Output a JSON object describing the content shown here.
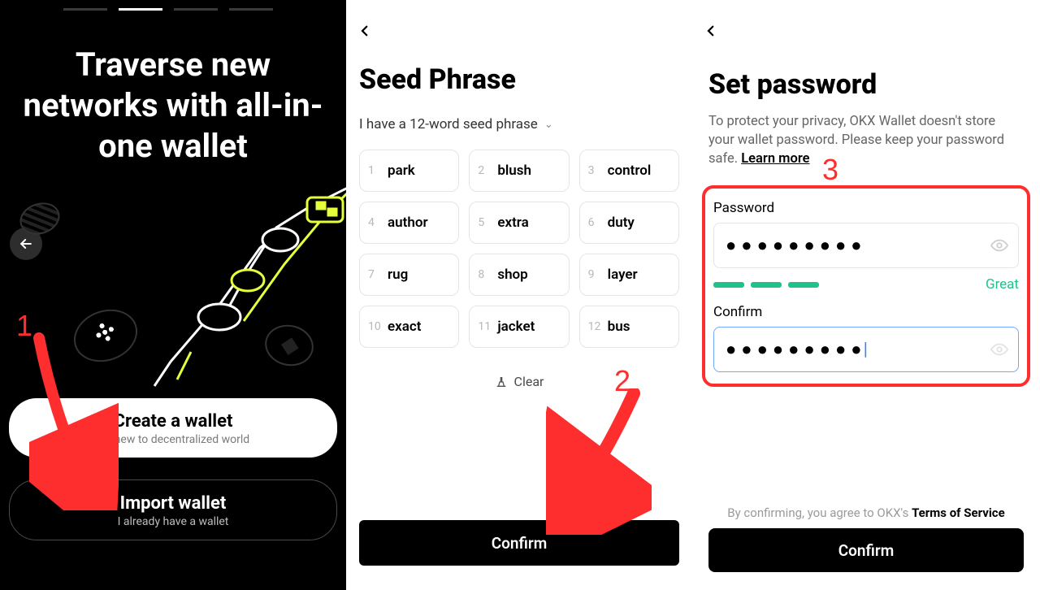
{
  "panel1": {
    "headline": "Traverse new networks with all-in-one wallet",
    "create": {
      "title": "Create a wallet",
      "subtitle": "I'm new to decentralized world"
    },
    "import": {
      "title": "Import wallet",
      "subtitle": "I already have a wallet"
    }
  },
  "panel2": {
    "title": "Seed Phrase",
    "subtitle": "I have a 12-word seed phrase",
    "words": [
      "park",
      "blush",
      "control",
      "author",
      "extra",
      "duty",
      "rug",
      "shop",
      "layer",
      "exact",
      "jacket",
      "bus"
    ],
    "clear": "Clear",
    "confirm": "Confirm"
  },
  "panel3": {
    "title": "Set password",
    "desc_pre": "To protect your privacy, OKX Wallet doesn't store your wallet password. Please keep your password safe.  ",
    "learn_more": "Learn more",
    "pw_label": "Password",
    "pw_value": "●●●●●●●●●",
    "strength": "Great",
    "confirm_label": "Confirm",
    "confirm_value": "●●●●●●●●●",
    "tos_pre": "By confirming, you agree to OKX's ",
    "tos_link": "Terms of Service",
    "confirm_btn": "Confirm"
  },
  "annotations": {
    "n1": "1",
    "n2": "2",
    "n3": "3"
  }
}
